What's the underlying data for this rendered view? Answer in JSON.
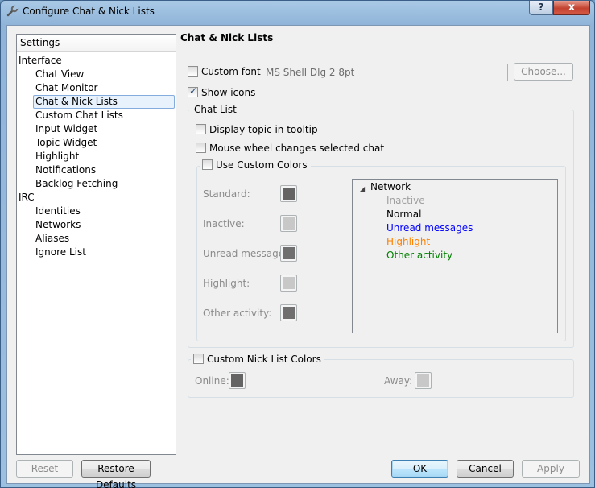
{
  "window": {
    "title": "Configure Chat & Nick Lists",
    "help_label": "?",
    "close_label": "x"
  },
  "tree": {
    "header": "Settings",
    "items": [
      {
        "label": "Interface",
        "level": 0
      },
      {
        "label": "Chat View",
        "level": 1
      },
      {
        "label": "Chat Monitor",
        "level": 1
      },
      {
        "label": "Chat & Nick Lists",
        "level": 1,
        "selected": true
      },
      {
        "label": "Custom Chat Lists",
        "level": 1
      },
      {
        "label": "Input Widget",
        "level": 1
      },
      {
        "label": "Topic Widget",
        "level": 1
      },
      {
        "label": "Highlight",
        "level": 1
      },
      {
        "label": "Notifications",
        "level": 1
      },
      {
        "label": "Backlog Fetching",
        "level": 1
      },
      {
        "label": "IRC",
        "level": 0
      },
      {
        "label": "Identities",
        "level": 1
      },
      {
        "label": "Networks",
        "level": 1
      },
      {
        "label": "Aliases",
        "level": 1
      },
      {
        "label": "Ignore List",
        "level": 1
      }
    ]
  },
  "page": {
    "title": "Chat & Nick Lists",
    "custom_font": {
      "label": "Custom font:",
      "checked": false,
      "value": "MS Shell Dlg 2 8pt",
      "choose_label": "Choose..."
    },
    "show_icons": {
      "label": "Show icons",
      "checked": true
    },
    "chat_list": {
      "title": "Chat List",
      "display_topic": {
        "label": "Display topic in tooltip",
        "checked": false
      },
      "mouse_wheel": {
        "label": "Mouse wheel changes selected chat",
        "checked": false
      },
      "custom_colors": {
        "label": "Use Custom Colors",
        "checked": false,
        "rows": [
          {
            "label": "Standard:",
            "color": "#646464"
          },
          {
            "label": "Inactive:",
            "color": "#c8c8c8"
          },
          {
            "label": "Unread messages:",
            "color": "#6f6f6f"
          },
          {
            "label": "Highlight:",
            "color": "#c8c8c8"
          },
          {
            "label": "Other activity:",
            "color": "#6f6f6f"
          }
        ],
        "preview": {
          "root": "Network",
          "items": [
            {
              "label": "Inactive",
              "color": "#a0a0a0"
            },
            {
              "label": "Normal",
              "color": "#000000"
            },
            {
              "label": "Unread messages",
              "color": "#0000ff"
            },
            {
              "label": "Highlight",
              "color": "#ff8000"
            },
            {
              "label": "Other activity",
              "color": "#008000"
            }
          ]
        }
      }
    },
    "nick_list": {
      "label": "Custom Nick List Colors",
      "checked": false,
      "online": {
        "label": "Online:",
        "color": "#646464"
      },
      "away": {
        "label": "Away:",
        "color": "#c8c8c8"
      }
    }
  },
  "buttons": {
    "reset": "Reset",
    "restore_defaults": "Restore Defaults",
    "ok": "OK",
    "cancel": "Cancel",
    "apply": "Apply"
  }
}
